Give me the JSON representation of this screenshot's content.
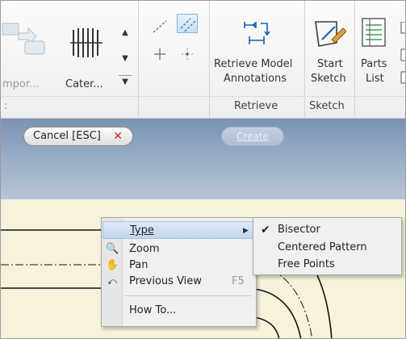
{
  "ribbon": {
    "import_label": "mpor...",
    "cater_label": "Cater...",
    "retrieve_label_line1": "Retrieve Model",
    "retrieve_label_line2": "Annotations",
    "start_sketch_line1": "Start",
    "start_sketch_line2": "Sketch",
    "parts_list_line1": "Parts",
    "parts_list_line2": "List",
    "group_retrieve": "Retrieve",
    "group_sketch": "Sketch"
  },
  "banner": {
    "cancel_label": "Cancel [ESC]",
    "cancel_x": "✕",
    "create_label": "Create"
  },
  "context_menu": {
    "items": [
      {
        "label": "Type",
        "underline": "T",
        "has_submenu": true,
        "icon": ""
      },
      {
        "label": "Zoom",
        "icon": "zoom-icon"
      },
      {
        "label": "Pan",
        "icon": "pan-hand-icon"
      },
      {
        "label": "Previous View",
        "shortcut": "F5",
        "icon": "previous-view-icon"
      },
      {
        "label": "How To...",
        "icon": ""
      }
    ]
  },
  "type_submenu": {
    "items": [
      {
        "label": "Bisector",
        "checked": true
      },
      {
        "label": "Centered Pattern",
        "checked": false
      },
      {
        "label": "Free Points",
        "checked": false
      }
    ]
  },
  "colors": {
    "banner_top": "#7a92b4",
    "banner_bottom": "#b7c4d6",
    "canvas": "#f7f2dc",
    "cancel_x": "#d02020",
    "menu_highlight": "#c3d6ee"
  }
}
